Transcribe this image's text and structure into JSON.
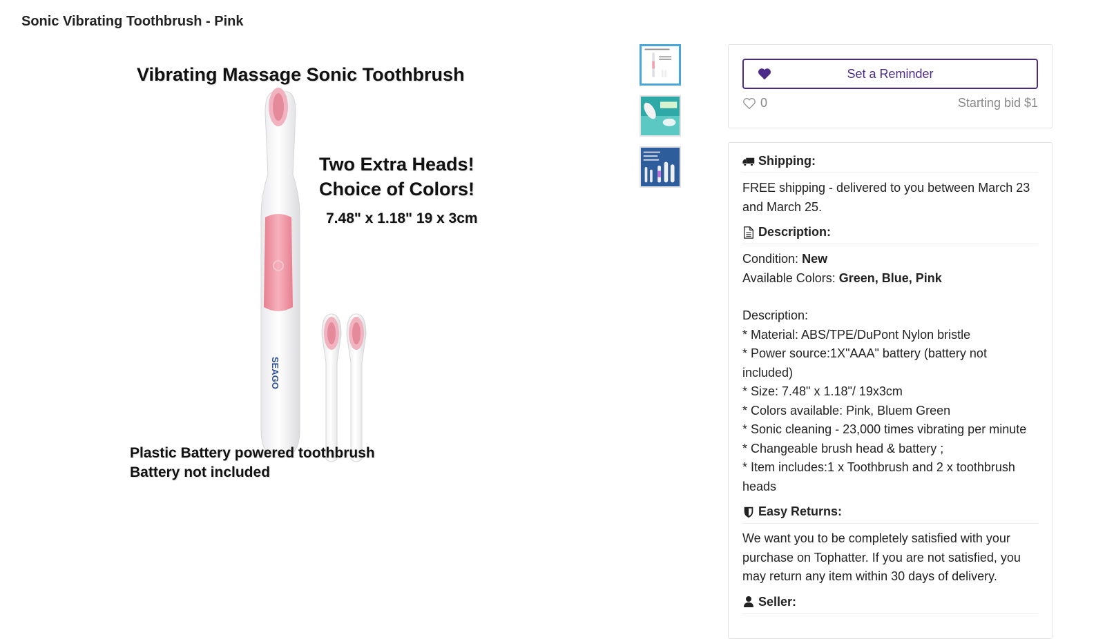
{
  "page": {
    "title": "Sonic Vibrating Toothbrush - Pink"
  },
  "product_image": {
    "headline": "Vibrating Massage Sonic Toothbrush",
    "extra_line1": "Two Extra Heads!",
    "extra_line2": "Choice of Colors!",
    "size_text": "7.48\" x 1.18\" 19 x 3cm",
    "brand_text": "SEAGO",
    "caption_line1": "Plastic Battery powered toothbrush",
    "caption_line2": "Battery not included"
  },
  "thumbnails": [
    {
      "name": "thumb-1",
      "active": true
    },
    {
      "name": "thumb-2",
      "active": false
    },
    {
      "name": "thumb-3",
      "active": false
    }
  ],
  "bid_panel": {
    "reminder_label": "Set a Reminder",
    "like_count": "0",
    "starting_bid": "Starting bid $1",
    "icons": {
      "reminder": "heart-icon",
      "like": "heart-outline-icon"
    },
    "accent_color": "#4b2a8a"
  },
  "shipping": {
    "heading": "Shipping:",
    "icon": "truck-icon",
    "text": "FREE shipping - delivered to you between March 23 and March 25."
  },
  "description": {
    "heading": "Description:",
    "icon": "document-icon",
    "condition_label": "Condition:",
    "condition_value": "New",
    "colors_label": "Available Colors:",
    "colors_value": "Green, Blue, Pink",
    "desc_title": "Description:",
    "lines": [
      "* Material: ABS/TPE/DuPont Nylon bristle",
      "* Power source:1X\"AAA\" battery (battery not included)",
      "* Size: 7.48\" x 1.18\"/ 19x3cm",
      "* Colors available: Pink, Bluem Green",
      "* Sonic cleaning - 23,000 times vibrating per minute",
      "* Changeable brush head & battery ;",
      "* Item includes:1 x Toothbrush and 2 x toothbrush heads"
    ]
  },
  "returns": {
    "heading": "Easy Returns:",
    "icon": "shield-icon",
    "text": "We want you to be completely satisfied with your purchase on Tophatter. If you are not satisfied, you may return any item within 30 days of delivery."
  },
  "seller": {
    "heading": "Seller:",
    "icon": "user-icon"
  }
}
